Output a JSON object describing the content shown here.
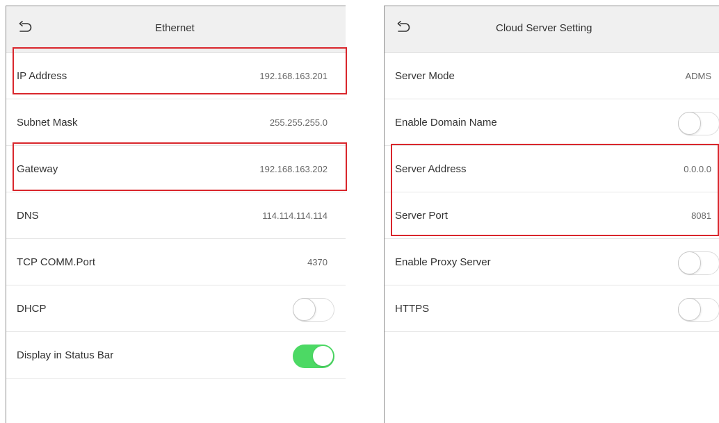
{
  "ethernet": {
    "title": "Ethernet",
    "rows": [
      {
        "label": "IP Address",
        "value": "192.168.163.201"
      },
      {
        "label": "Subnet Mask",
        "value": "255.255.255.0"
      },
      {
        "label": "Gateway",
        "value": "192.168.163.202"
      },
      {
        "label": "DNS",
        "value": "114.114.114.114"
      },
      {
        "label": "TCP COMM.Port",
        "value": "4370"
      },
      {
        "label": "DHCP",
        "toggle": "off"
      },
      {
        "label": "Display in Status Bar",
        "toggle": "on"
      }
    ]
  },
  "cloud_server": {
    "title": "Cloud Server Setting",
    "rows": [
      {
        "label": "Server Mode",
        "value": "ADMS"
      },
      {
        "label": "Enable Domain Name",
        "toggle": "off"
      },
      {
        "label": "Server Address",
        "value": "0.0.0.0"
      },
      {
        "label": "Server Port",
        "value": "8081"
      },
      {
        "label": "Enable Proxy Server",
        "toggle": "off"
      },
      {
        "label": "HTTPS",
        "toggle": "off"
      }
    ]
  },
  "icons": {
    "back": "back-arrow-icon"
  },
  "colors": {
    "header_bg": "#f0f0f0",
    "highlight": "#d9262c",
    "toggle_on": "#4cd964"
  }
}
